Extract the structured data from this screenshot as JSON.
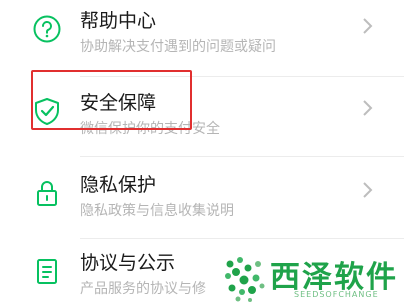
{
  "menu": {
    "items": [
      {
        "icon": "question-circle-icon",
        "title": "帮助中心",
        "subtitle": "协助解决支付遇到的问题或疑问"
      },
      {
        "icon": "shield-check-icon",
        "title": "安全保障",
        "subtitle": "微信保护你的支付安全"
      },
      {
        "icon": "lock-icon",
        "title": "隐私保护",
        "subtitle": "隐私政策与信息收集说明"
      },
      {
        "icon": "document-icon",
        "title": "协议与公示",
        "subtitle": "产品服务的协议与修"
      }
    ]
  },
  "watermark": {
    "title": "西泽软件",
    "subtitle": "SEEDSOFCHANGE"
  },
  "colors": {
    "accent": "#07c160",
    "highlight": "#e12f2f",
    "watermark": "#1fa34a"
  }
}
